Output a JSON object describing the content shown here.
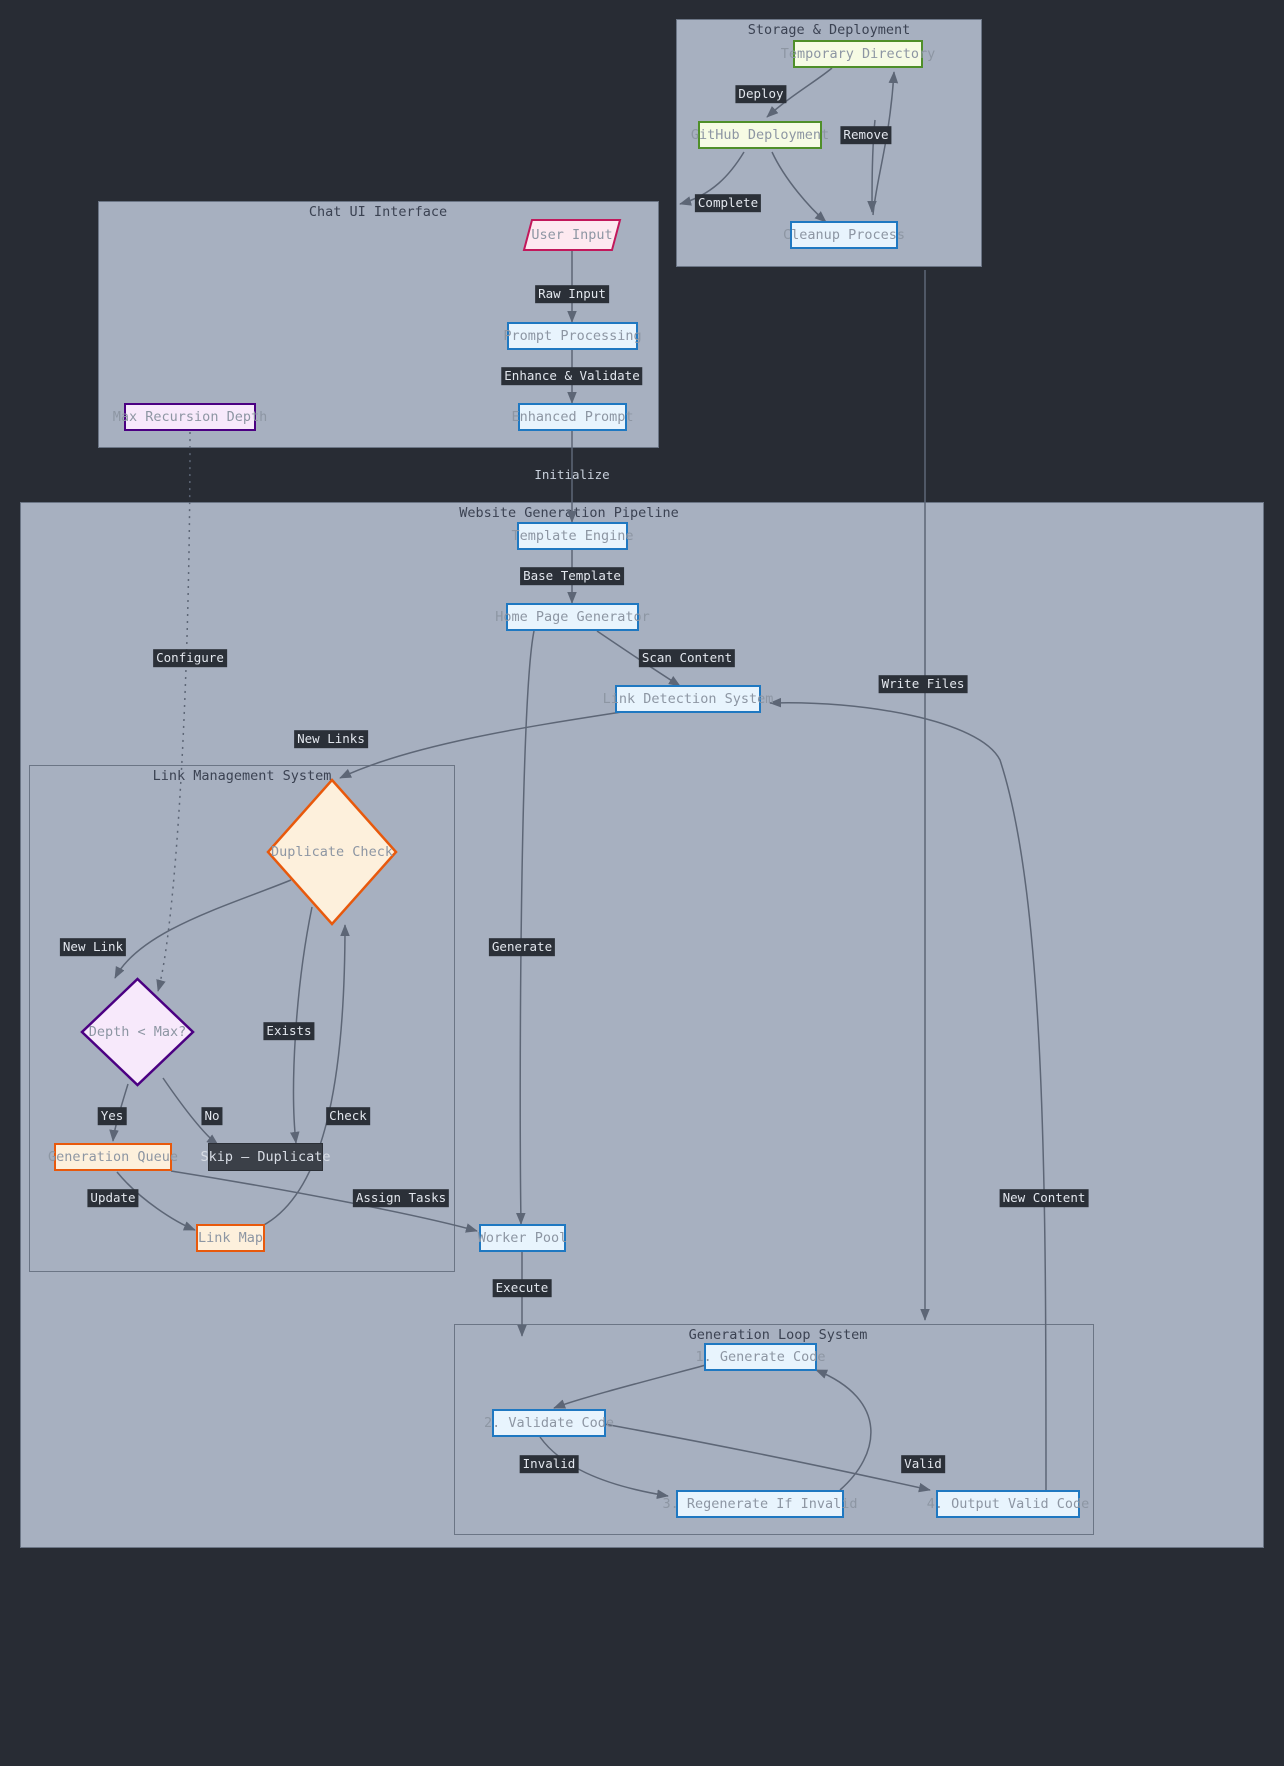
{
  "diagram": {
    "type": "flowchart",
    "theme": {
      "background": "#282c34",
      "cluster_fill": "#a7b0c0",
      "cluster_border": "#6b7585",
      "edge_color": "#5d6676",
      "label_bg": "#2b3038",
      "label_text": "#e3e7ee",
      "node_text": "#8d96a3",
      "blue_fill": "#e8f4fd",
      "blue_border": "#1f78c1",
      "green_fill": "#f6fbe4",
      "green_border": "#4f8f29",
      "orange_fill": "#fdf0dc",
      "orange_border": "#e8590c",
      "pink_fill": "#fde9f0",
      "pink_border": "#c2185b",
      "purple_fill": "#f7e9fb",
      "purple_border": "#4b0082",
      "dark_fill": "#3b4048"
    }
  },
  "clusters": [
    {
      "id": "storage",
      "title": "Storage & Deployment"
    },
    {
      "id": "chatui",
      "title": "Chat UI Interface"
    },
    {
      "id": "pipeline",
      "title": "Website Generation Pipeline"
    },
    {
      "id": "linkmgmt",
      "title": "Link Management System"
    },
    {
      "id": "genloop",
      "title": "Generation Loop System"
    }
  ],
  "nodes": {
    "temp_directory": {
      "label": "Temporary Directory",
      "style": "green"
    },
    "github_deployment": {
      "label": "GitHub Deployment",
      "style": "green"
    },
    "cleanup_process": {
      "label": "Cleanup Process",
      "style": "blue"
    },
    "user_input": {
      "label": "User Input",
      "style": "pink-parallelogram"
    },
    "prompt_processing": {
      "label": "Prompt Processing",
      "style": "blue"
    },
    "enhanced_prompt": {
      "label": "Enhanced Prompt",
      "style": "blue"
    },
    "max_recursion": {
      "label": "Max Recursion Depth",
      "style": "purple"
    },
    "template_engine": {
      "label": "Template Engine",
      "style": "blue"
    },
    "home_page_gen": {
      "label": "Home Page Generator",
      "style": "blue"
    },
    "link_detection": {
      "label": "Link Detection System",
      "style": "blue"
    },
    "duplicate_check": {
      "label": "Duplicate Check",
      "style": "orange-diamond"
    },
    "depth_check": {
      "label": "Depth < Max?",
      "style": "purple-diamond"
    },
    "generation_queue": {
      "label": "Generation Queue",
      "style": "orange"
    },
    "skip_duplicate": {
      "label": "Skip — Duplicate",
      "style": "dark"
    },
    "link_map": {
      "label": "Link Map",
      "style": "orange"
    },
    "worker_pool": {
      "label": "Worker Pool",
      "style": "blue"
    },
    "generate_code": {
      "label": "1. Generate Code",
      "style": "blue"
    },
    "validate_code": {
      "label": "2. Validate Code",
      "style": "blue"
    },
    "regenerate_code": {
      "label": "3. Regenerate If Invalid",
      "style": "blue"
    },
    "output_code": {
      "label": "4. Output Valid Code",
      "style": "blue"
    }
  },
  "edge_labels": {
    "deploy": "Deploy",
    "remove": "Remove",
    "complete": "Complete",
    "raw_input": "Raw Input",
    "enhance": "Enhance & Validate",
    "initialize": "Initialize",
    "base_template": "Base Template",
    "scan_content": "Scan Content",
    "write_files": "Write Files",
    "new_links": "New Links",
    "configure": "Configure",
    "new_link": "New Link",
    "exists": "Exists",
    "check": "Check",
    "yes": "Yes",
    "no": "No",
    "update": "Update",
    "assign_tasks": "Assign Tasks",
    "generate": "Generate",
    "execute": "Execute",
    "new_content": "New Content",
    "invalid": "Invalid",
    "valid": "Valid"
  }
}
